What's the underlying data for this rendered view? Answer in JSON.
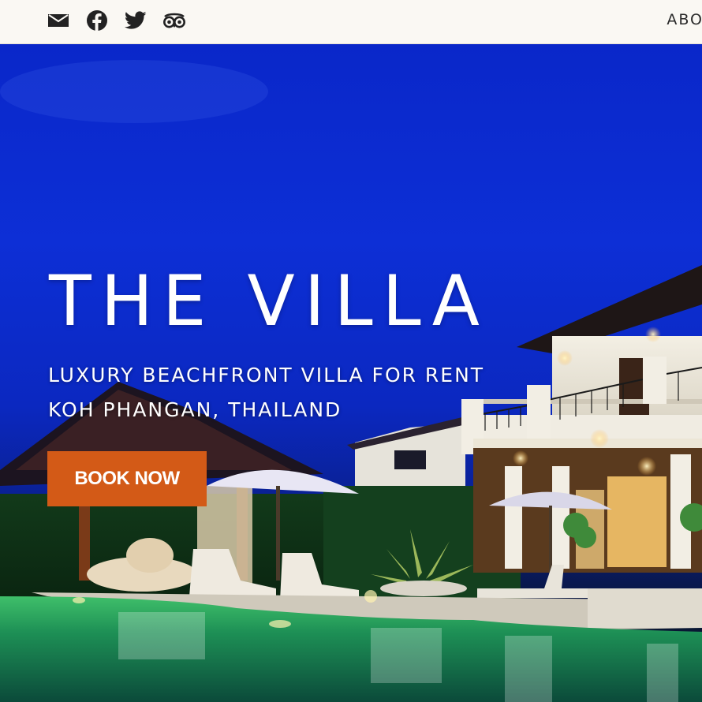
{
  "header": {
    "social_icons": [
      "mail-icon",
      "facebook-icon",
      "twitter-icon",
      "tripadvisor-icon"
    ],
    "nav": {
      "about_label": "ABO"
    }
  },
  "hero": {
    "title": "THE VILLA",
    "subtitle_line1": "LUXURY BEACHFRONT VILLA FOR RENT",
    "subtitle_line2": "KOH PHANGAN, THAILAND",
    "cta_label": "BOOK NOW"
  },
  "colors": {
    "header_bg": "#faf8f3",
    "icon_color": "#222222",
    "sky": "#0d2fd6",
    "cta_bg": "#d35a17",
    "text": "#ffffff"
  }
}
